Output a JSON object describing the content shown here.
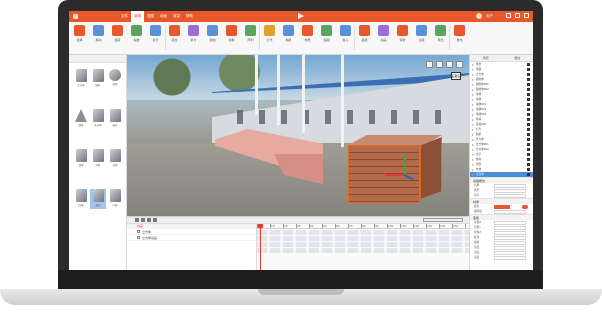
{
  "app": {
    "menu_tabs": [
      "文件",
      "编辑",
      "视图",
      "动画",
      "渲染",
      "帮助"
    ],
    "active_tab_index": 1,
    "user_name": "用户",
    "accent_color": "#e8582a"
  },
  "ribbon": {
    "tools": [
      "选择",
      "移动",
      "旋转",
      "缩放",
      "对齐",
      "组合",
      "拆分",
      "复制",
      "镜像",
      "阵列",
      "灯光",
      "相机",
      "材质",
      "贴图",
      "粒子",
      "路径",
      "动画",
      "特效",
      "渲染",
      "导出",
      "发布"
    ]
  },
  "left_panel": {
    "assets": [
      {
        "label": "立方体",
        "shape": "box"
      },
      {
        "label": "圆柱",
        "shape": "box"
      },
      {
        "label": "球体",
        "shape": "round"
      },
      {
        "label": "圆锥",
        "shape": "cone"
      },
      {
        "label": "长方体",
        "shape": "box"
      },
      {
        "label": "棱柱",
        "shape": "box"
      },
      {
        "label": "墙体",
        "shape": "box"
      },
      {
        "label": "台阶",
        "shape": "box"
      },
      {
        "label": "柱体",
        "shape": "box"
      },
      {
        "label": "砖墙",
        "shape": "box"
      },
      {
        "label": "板材",
        "shape": "box"
      },
      {
        "label": "门窗",
        "shape": "box"
      }
    ],
    "selected_index": 10
  },
  "viewport": {
    "tool_icons": [
      "move-icon",
      "rotate-icon",
      "scale-icon",
      "camera-icon"
    ],
    "logo_text": "ERS"
  },
  "timeline": {
    "header": "动画",
    "rows": [
      "立方体",
      "立方体动画"
    ],
    "ruler_marks": [
      "0",
      "10",
      "20",
      "30",
      "40",
      "50",
      "60",
      "70",
      "80",
      "90",
      "100",
      "110",
      "120",
      "130",
      "140",
      "150"
    ]
  },
  "right_panel": {
    "tabs": [
      "场景",
      "属性"
    ],
    "tree": [
      "场景",
      "地面",
      "立方体",
      "圆柱体",
      "圆柱体001",
      "圆柱体002",
      "球体",
      "墙体",
      "墙体001",
      "墙体002",
      "墙体003",
      "砖墙",
      "砖墙001",
      "灯光",
      "相机",
      "长方体",
      "长方体001",
      "长方体002",
      "文字",
      "板材",
      "台阶",
      "柱体",
      "立方体"
    ],
    "selected_tree_index": 22,
    "sections": [
      {
        "title": "基础属性",
        "rows": [
          "名称",
          "类型",
          "显示"
        ]
      },
      {
        "title": "材质",
        "rows": [
          "颜色",
          "透明度"
        ]
      },
      {
        "title": "变换",
        "rows": [
          "位置X",
          "位置Y",
          "位置Z",
          "旋转",
          "缩放",
          "宽度",
          "高度",
          "深度"
        ]
      }
    ]
  }
}
